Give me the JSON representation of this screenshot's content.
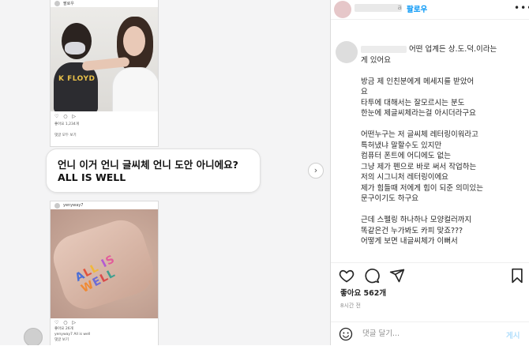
{
  "screenshot": {
    "left_pane": {
      "top_card": {
        "username": "팔로우",
        "shirt_text": "K FLOYD",
        "action_icons": "♡ ○ ▷",
        "caption": "좋아요 1,234개",
        "comment": "댓글 모두 보기"
      },
      "message_bubble": {
        "line1": "언니 이거 언니 글씨체 언니 도안 아니에요?",
        "line2": "ALL IS WELL"
      },
      "bottom_card": {
        "username": "yenyway7",
        "tattoo_text": "ALL IS WELL",
        "action_icons": "♡ ○ ▷",
        "likes_line": "좋아요 26개",
        "caption_line": "yenyway7 All is well",
        "comments_line": "댓글 보기"
      },
      "next_arrow": "›"
    },
    "post_panel": {
      "header": {
        "username_fragment": "a",
        "follow_label": "팔로우",
        "more_label": "•••"
      },
      "caption_lines": [
        "어떤 업계든 상.도.덕.이라는",
        "게 있어요",
        "",
        "방금 제 인친분에게 메세지를 받았어",
        "요",
        "타투에 대해서는 잘모르시는 분도",
        "한눈에 제글씨체라는걸 아시더라구요",
        "",
        "어떤누구는 저 글씨체 레터링이워라고",
        "특허냈냐 말할수도 있지만",
        "컴퓨터 폰트에 어디에도 없는",
        "그냥 제가 펜으로 바로 써서 작업하는",
        "저의 시그니처 레터링이에요",
        "제가 힘들때 저에게 힘이 되준 의미있는",
        "문구이기도 하구요",
        "",
        "근데 스펠링 하나하나 모양컬러까지",
        "똑같은건 누가봐도 카피 맞죠???",
        "어떻게 보면 내글씨체가 이뻐서"
      ],
      "likes": "좋아요 562개",
      "time_ago": "8시간 전",
      "comment_placeholder": "댓글 달기...",
      "post_label": "게시"
    }
  },
  "colors": {
    "accent": "#0095f6",
    "post_disabled": "#b2dffc",
    "left_bg": "#f4f4f5",
    "tattoo": [
      "#4b6fd6",
      "#e2533c",
      "#f0b83a",
      "#3fae6a",
      "#b35bd1",
      "#e25c9a",
      "#47b7d6",
      "#f08a34",
      "#6c6cd6",
      "#d84b4b",
      "#3f9f8f"
    ]
  }
}
